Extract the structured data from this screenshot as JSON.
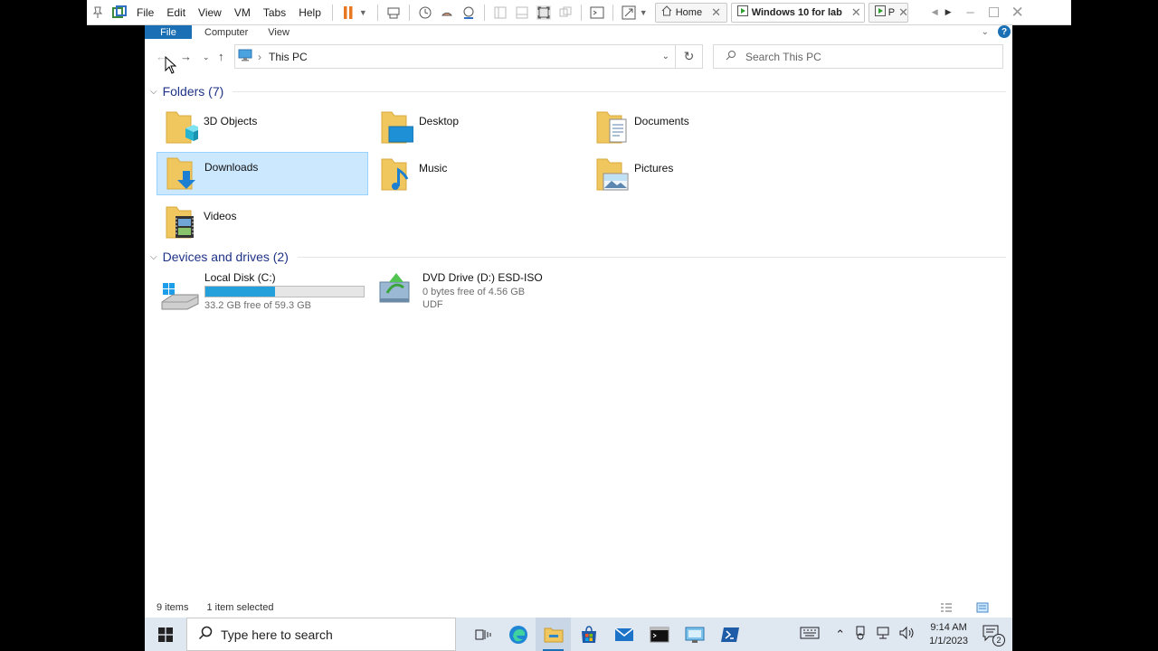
{
  "vmware": {
    "menu": [
      "File",
      "Edit",
      "View",
      "VM",
      "Tabs",
      "Help"
    ],
    "tabs": [
      {
        "label": "Home"
      },
      {
        "label": "Windows 10 for lab"
      },
      {
        "label": "P"
      }
    ]
  },
  "ribbon": {
    "tabs": [
      "File",
      "Computer",
      "View"
    ],
    "help": "?"
  },
  "navigation": {
    "address": "This PC",
    "search_placeholder": "Search This PC"
  },
  "folders_group": {
    "title": "Folders (7)",
    "items": [
      "3D Objects",
      "Desktop",
      "Documents",
      "Downloads",
      "Music",
      "Pictures",
      "Videos"
    ],
    "selected": "Downloads"
  },
  "drives_group": {
    "title": "Devices and drives (2)",
    "drives": [
      {
        "name": "Local Disk (C:)",
        "free_text": "33.2 GB free of 59.3 GB",
        "used_fraction": 0.44
      },
      {
        "name": "DVD Drive (D:) ESD-ISO",
        "free_text": "0 bytes free of 4.56 GB",
        "fs": "UDF"
      }
    ]
  },
  "status": {
    "items": "9 items",
    "selected": "1 item selected"
  },
  "taskbar": {
    "search_placeholder": "Type here to search",
    "time": "9:14 AM",
    "date": "1/1/2023",
    "notifications": "2"
  },
  "colors": {
    "accent": "#1a6fb5",
    "selection": "#cce8ff",
    "disk_bar": "#26a0da",
    "folder": "#f0c75e"
  }
}
